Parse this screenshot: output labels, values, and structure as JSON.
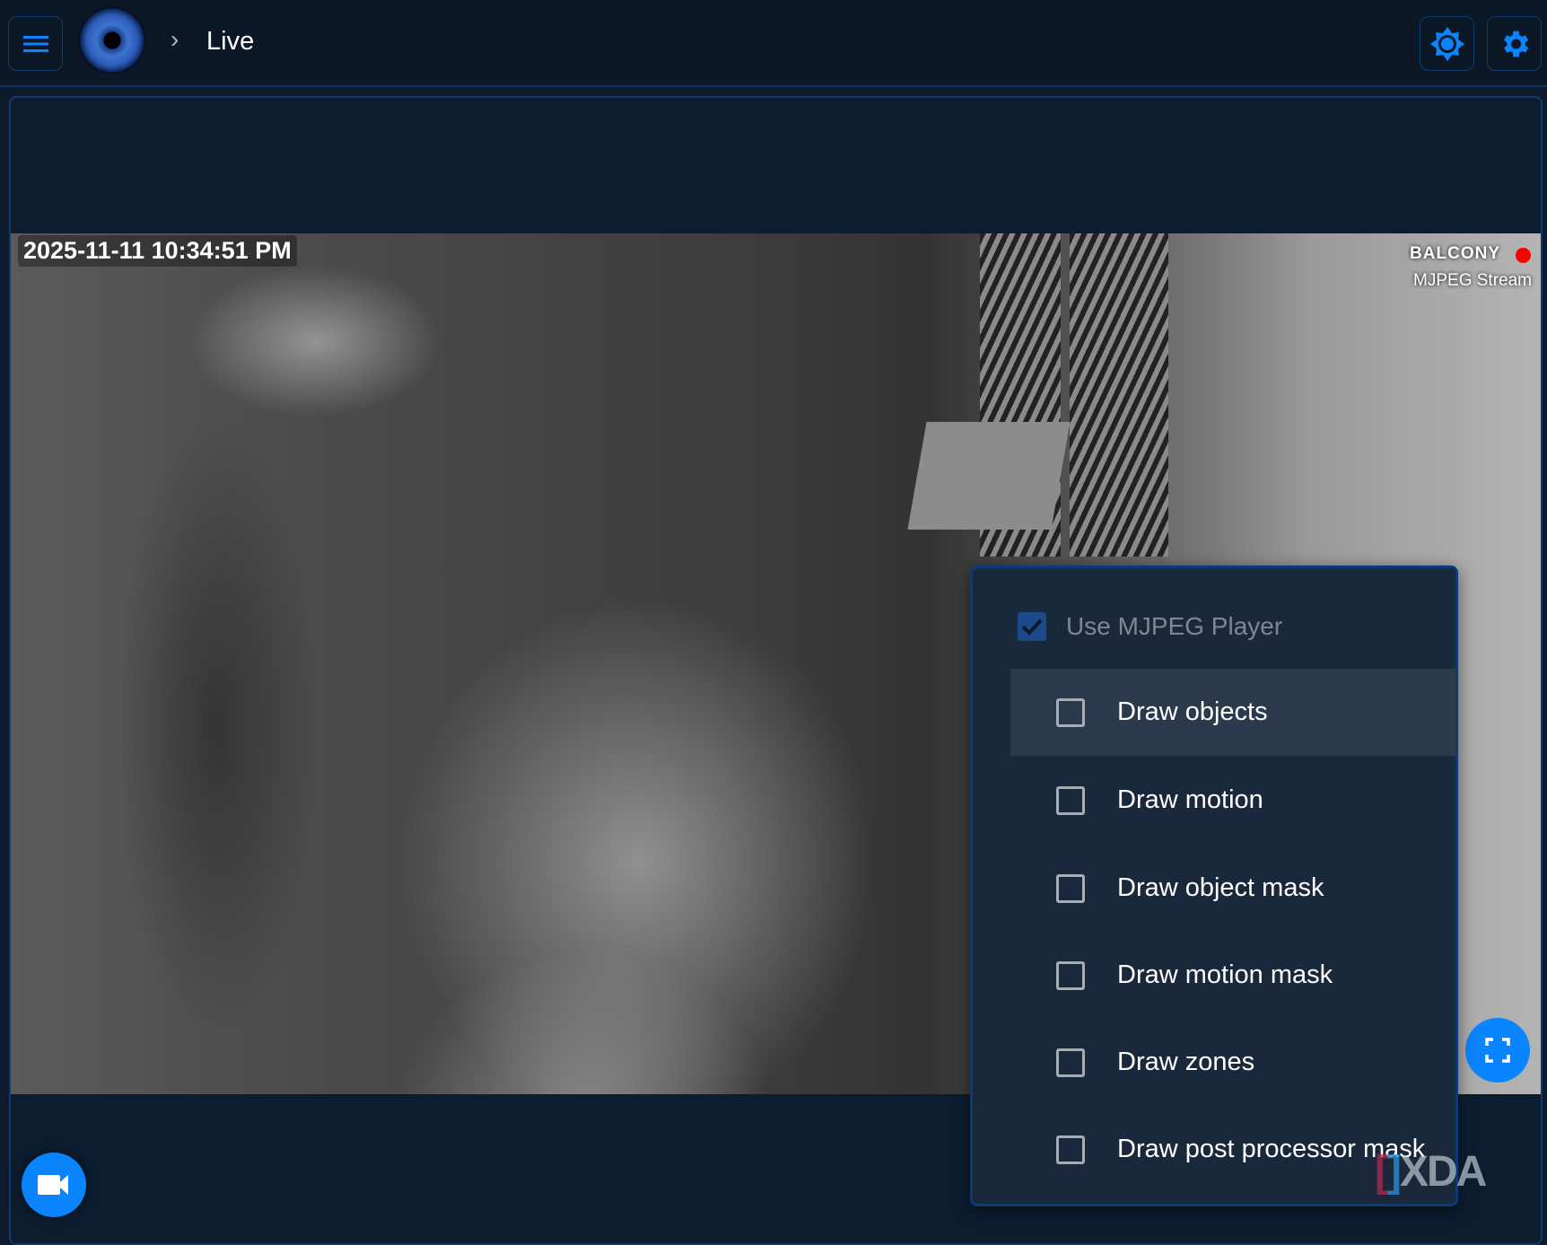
{
  "header": {
    "breadcrumb_separator": "›",
    "page": "Live"
  },
  "camera": {
    "timestamp": "2025-11-11  10:34:51 PM",
    "name": "BALCONY",
    "stream_type": "MJPEG Stream",
    "recording": true
  },
  "menu": {
    "use_mjpeg": {
      "label": "Use MJPEG Player",
      "checked": true
    },
    "options": [
      {
        "label": "Draw objects",
        "checked": false,
        "highlighted": true
      },
      {
        "label": "Draw motion",
        "checked": false
      },
      {
        "label": "Draw object mask",
        "checked": false
      },
      {
        "label": "Draw motion mask",
        "checked": false
      },
      {
        "label": "Draw zones",
        "checked": false
      },
      {
        "label": "Draw post processor mask",
        "checked": false
      }
    ]
  },
  "watermark": "XDA",
  "colors": {
    "accent": "#0a84ff",
    "background": "#0c1a2b",
    "menu_bg": "#1a283b",
    "record": "#ff0000"
  }
}
